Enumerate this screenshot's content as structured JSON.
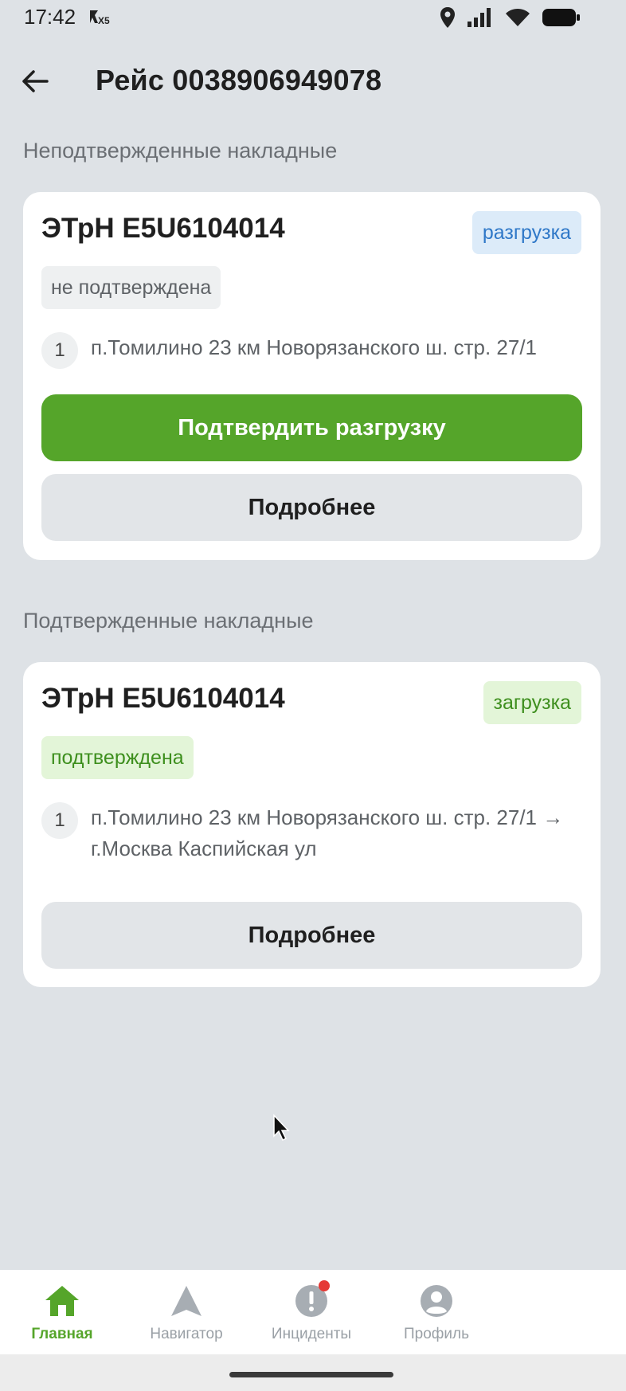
{
  "status_bar": {
    "time": "17:42",
    "carrier_badge": "X5"
  },
  "header": {
    "title": "Рейс 0038906949078"
  },
  "unconfirmed": {
    "section_title": "Неподтвержденные накладные",
    "card": {
      "title": "ЭТрН E5U6104014",
      "type_label": "разгрузка",
      "status_label": "не подтверждена",
      "route_index": "1",
      "route_text": "п.Томилино 23 км Новорязанского ш. стр. 27/1",
      "confirm_label": "Подтвердить разгрузку",
      "details_label": "Подробнее"
    }
  },
  "confirmed": {
    "section_title": "Подтвержденные накладные",
    "card": {
      "title": "ЭТрН E5U6104014",
      "type_label": "загрузка",
      "status_label": "подтверждена",
      "route_index": "1",
      "route_text": "п.Томилино 23 км Новорязанского ш. стр. 27/1 → г.Москва Каспийская ул",
      "details_label": "Подробнее"
    }
  },
  "bottom_nav": {
    "items": [
      {
        "label": "Главная",
        "icon": "home-icon",
        "active": true
      },
      {
        "label": "Навигатор",
        "icon": "navigation-arrow-icon",
        "active": false
      },
      {
        "label": "Инциденты",
        "icon": "alert-icon",
        "active": false
      },
      {
        "label": "Профиль",
        "icon": "profile-icon",
        "active": false
      }
    ]
  },
  "colors": {
    "background": "#dee2e6",
    "accent_green": "#55a52a",
    "unload_badge_text": "#2f78c8",
    "load_badge_text": "#3e8f1e",
    "notification_dot": "#e53935"
  }
}
